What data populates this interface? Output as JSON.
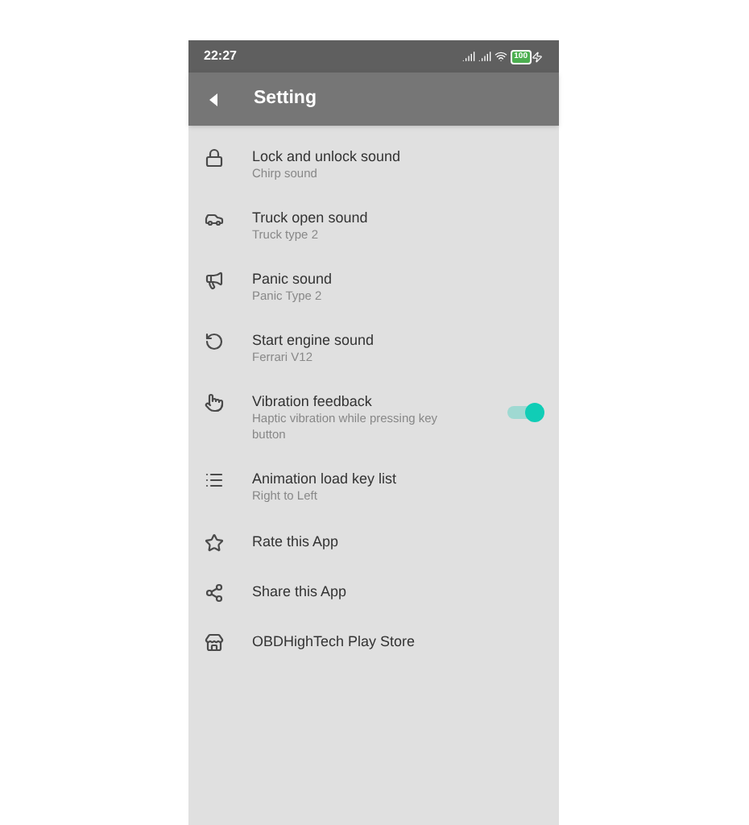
{
  "status_bar": {
    "time": "22:27",
    "battery": "100"
  },
  "app_bar": {
    "title": "Setting"
  },
  "items": [
    {
      "kind": "setting",
      "title": "Lock and unlock sound",
      "subtitle": "Chirp sound"
    },
    {
      "kind": "setting",
      "title": "Truck open sound",
      "subtitle": "Truck type 2"
    },
    {
      "kind": "setting",
      "title": "Panic sound",
      "subtitle": "Panic Type 2"
    },
    {
      "kind": "setting",
      "title": "Start engine sound",
      "subtitle": "Ferrari V12"
    },
    {
      "kind": "toggle",
      "title": "Vibration feedback",
      "subtitle": "Haptic vibration while pressing key button",
      "on": true
    },
    {
      "kind": "setting",
      "title": "Animation load key list",
      "subtitle": "Right to Left"
    },
    {
      "kind": "link",
      "title": "Rate this App"
    },
    {
      "kind": "link",
      "title": "Share this App"
    },
    {
      "kind": "link",
      "title": "OBDHighTech Play Store"
    }
  ]
}
